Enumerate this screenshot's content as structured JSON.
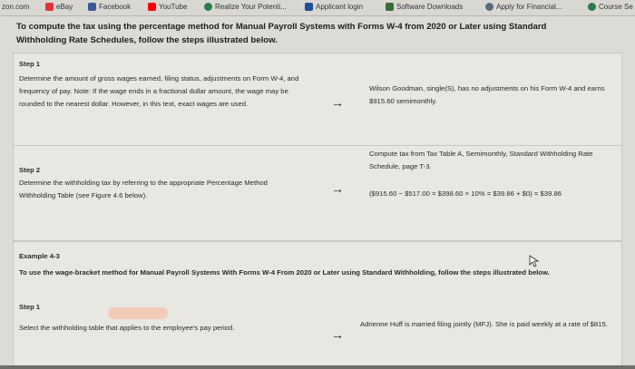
{
  "bookmarks": {
    "items": [
      {
        "label": "zon.com",
        "color": "#999999"
      },
      {
        "label": "eBay",
        "color": "#e53238"
      },
      {
        "label": "Facebook",
        "color": "#3b5998"
      },
      {
        "label": "YouTube",
        "color": "#ff0000"
      },
      {
        "label": "Realize Your Potenti...",
        "color": "#2c7a4b"
      },
      {
        "label": "Applicant login",
        "color": "#1f4e9b"
      },
      {
        "label": "Software Downloads",
        "color": "#3a6b35"
      },
      {
        "label": "Apply for Financial...",
        "color": "#5b6b7a"
      },
      {
        "label": "Course Se",
        "color": "#2c7a4b"
      }
    ]
  },
  "doc": {
    "title": "To compute the tax using the percentage method for Manual Payroll Systems with Forms W-4 from 2020 or Later using Standard Withholding Rate Schedules, follow the steps illustrated below.",
    "step1": {
      "label": "Step 1",
      "left": "Determine the amount of gross wages earned, filing status, adjustments on Form W-4, and frequency of pay. Note: If the wage ends in a fractional dollar amount, the wage may be rounded to the nearest dollar. However, in this text, exact wages are used.",
      "arrow": "→",
      "right": "Wilson Goodman, single(S), has no adjustments on his Form W-4 and earns $915.60 semimonthly."
    },
    "step2": {
      "label": "Step 2",
      "left": "Determine the withholding tax by referring to the appropriate Percentage Method Withholding Table (see Figure 4.6 below).",
      "arrow": "→",
      "right_top": "Compute tax from Tax Table A, Semimonthly, Standard Withholding Rate Schedule, page T-3.",
      "right_bottom": "($915.60 − $517.00 = $398.60 × 10% = $39.86 + $0) = $39.86"
    },
    "example": {
      "heading": "Example 4-3",
      "intro": "To use the wage-bracket method for Manual Payroll Systems With Forms W-4 From 2020 or Later using Standard Withholding, follow the steps illustrated below.",
      "step_label": "Step 1",
      "left": "Select the withholding table that applies to the employee's pay period.",
      "arrow": "→",
      "right": "Adrienne Huff is married filing jointly (MFJ). She is paid weekly at a rate of $815."
    }
  }
}
